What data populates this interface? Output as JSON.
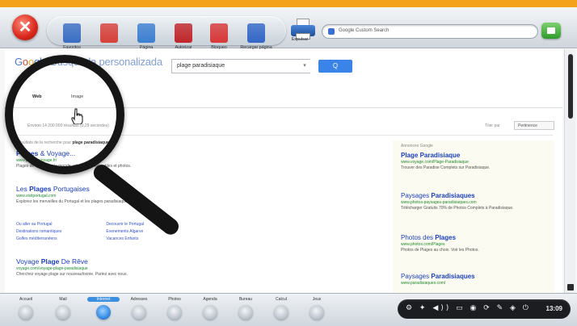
{
  "toolbar": {
    "tools": [
      {
        "label": "Favoritos",
        "color": "#3a6ec4"
      },
      {
        "label": "",
        "color": "#d7413a"
      },
      {
        "label": "Página",
        "color": "#3d7fd2"
      },
      {
        "label": "Autorizar",
        "color": "#c0262a"
      },
      {
        "label": "Bloqueo",
        "color": "#d83838"
      },
      {
        "label": "Recargar página",
        "color": "#3367c7"
      },
      {
        "label": "Expulsar",
        "color": "#2f63b8"
      }
    ],
    "url_text": "Google Custom Search"
  },
  "browser": {
    "logo": "Búsqueda personalizada",
    "search_value": "plage paradisiaque",
    "search_button": "Q",
    "tabs": {
      "web": "Web",
      "images": "Image"
    },
    "stats": "Environ 14 200 000 résultats (0,29 secondes)",
    "sort_label": "Trier par",
    "sort_value": "Pertinence",
    "note": "Résultats de la recherche pour",
    "note_query": "plage paradisiaque",
    "results": [
      {
        "title": "Plages & Voyage...",
        "url": "www.plages-voyage.fr/",
        "snippet": "Plages de rêve dans le monde, infos et conseils utiles et photos."
      },
      {
        "title": "Les Plages Portugaises",
        "url": "www.visitportugal.com",
        "snippet": "Explorez les merveilles du Portugal et les plages paradisiaques offert..."
      },
      {
        "title": "Voyage Plage De Rêve",
        "url": "voyage.com/voyage-plage-paradisiaque",
        "snippet": "Cherchez voyage plage sur nouveaufoonie. Partez avec nous."
      }
    ],
    "sublinks": [
      [
        "Ou aller au Portugal",
        "Decouvrir le Portugal"
      ],
      [
        "Destinations romantiques",
        "Evenements Algarve"
      ],
      [
        "Golfes méditerranéens",
        "Vacances Enfants"
      ]
    ],
    "ads_header": "Annonces Google",
    "ads": [
      {
        "title": "Plage Paradisiaque",
        "url": "www.voyage.com/Plage-Paradisiaque",
        "snippet": "Trouver des Paradise Complets sur Paradisiaque."
      },
      {
        "title": "Paysages Paradisiaques",
        "url": "www.photos-paysages-paradisiaques.com",
        "snippet": "Télécharger Gratuits 70% de Photos Complets à Paradisiaque."
      },
      {
        "title": "Photos des Plages",
        "url": "www.photos.com/Plages",
        "snippet": "Photos de Plages au choix. Voir les Photos."
      },
      {
        "title": "Paysages Paradisiaques",
        "url": "www.paradisiaques.com/",
        "snippet": ""
      }
    ]
  },
  "dock": {
    "items": [
      {
        "label": "Accueil"
      },
      {
        "label": "Mail"
      },
      {
        "label": "Internet",
        "active": true
      },
      {
        "label": "Adresses"
      },
      {
        "label": "Photos"
      },
      {
        "label": "Agenda"
      },
      {
        "label": "Bureau"
      },
      {
        "label": "Calcul"
      },
      {
        "label": "Jeux"
      }
    ],
    "tray_glyphs": "⚙ ✦ ◀)) ▭ ◉ ⟳ ✎ ◈ ⏻",
    "clock": "13:09"
  }
}
